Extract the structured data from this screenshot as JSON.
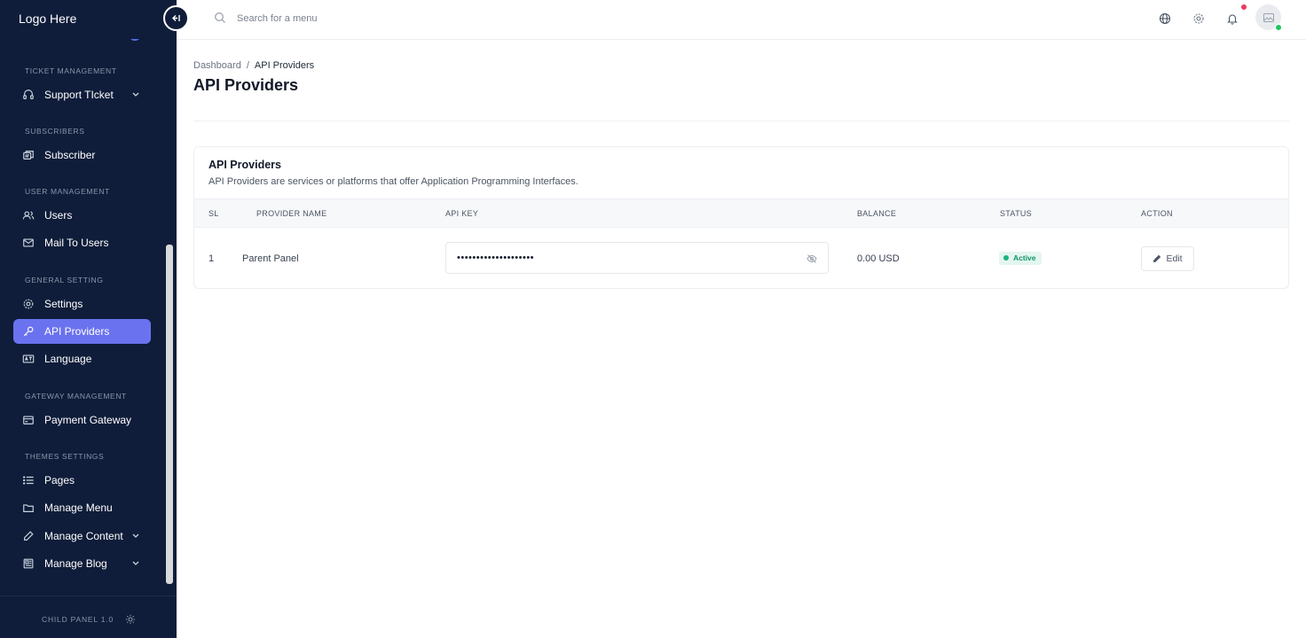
{
  "app": {
    "logo": "Logo Here",
    "version": "CHILD PANEL 1.0"
  },
  "search": {
    "placeholder": "Search for a menu"
  },
  "sidebar": {
    "sections": [
      {
        "title": "TICKET MANAGEMENT",
        "items": [
          {
            "label": "Support TIcket",
            "icon": "headset-icon",
            "has_submenu": true
          }
        ]
      },
      {
        "title": "SUBSCRIBERS",
        "items": [
          {
            "label": "Subscriber",
            "icon": "subscriber-icon"
          }
        ]
      },
      {
        "title": "USER MANAGEMENT",
        "items": [
          {
            "label": "Users",
            "icon": "users-icon"
          },
          {
            "label": "Mail To Users",
            "icon": "mail-icon"
          }
        ]
      },
      {
        "title": "GENERAL SETTING",
        "items": [
          {
            "label": "Settings",
            "icon": "gear-icon"
          },
          {
            "label": "API Providers",
            "icon": "key-icon",
            "active": true
          },
          {
            "label": "Language",
            "icon": "language-icon"
          }
        ]
      },
      {
        "title": "GATEWAY MANAGEMENT",
        "items": [
          {
            "label": "Payment Gateway",
            "icon": "wallet-icon"
          }
        ]
      },
      {
        "title": "THEMES SETTINGS",
        "items": [
          {
            "label": "Pages",
            "icon": "list-icon"
          },
          {
            "label": "Manage Menu",
            "icon": "folder-icon"
          },
          {
            "label": "Manage Content",
            "icon": "pencil-icon",
            "has_submenu": true
          },
          {
            "label": "Manage Blog",
            "icon": "blog-icon",
            "has_submenu": true
          }
        ]
      }
    ]
  },
  "breadcrumb": {
    "parent": "Dashboard",
    "separator": "/",
    "current": "API Providers"
  },
  "page": {
    "title": "API Providers"
  },
  "card": {
    "title": "API Providers",
    "description": "API Providers are services or platforms that offer Application Programming Interfaces.",
    "columns": [
      "SL",
      "PROVIDER NAME",
      "API KEY",
      "BALANCE",
      "STATUS",
      "ACTION"
    ],
    "rows": [
      {
        "sl": "1",
        "provider_name": "Parent Panel",
        "api_key_masked": "••••••••••••••••••••",
        "balance": "0.00 USD",
        "status": "Active",
        "action": "Edit"
      }
    ]
  },
  "colors": {
    "sidebar_bg": "#0f1d3a",
    "active_item": "#6b72ef",
    "status_active": "#19b37d",
    "notification": "#ea3a5c"
  }
}
